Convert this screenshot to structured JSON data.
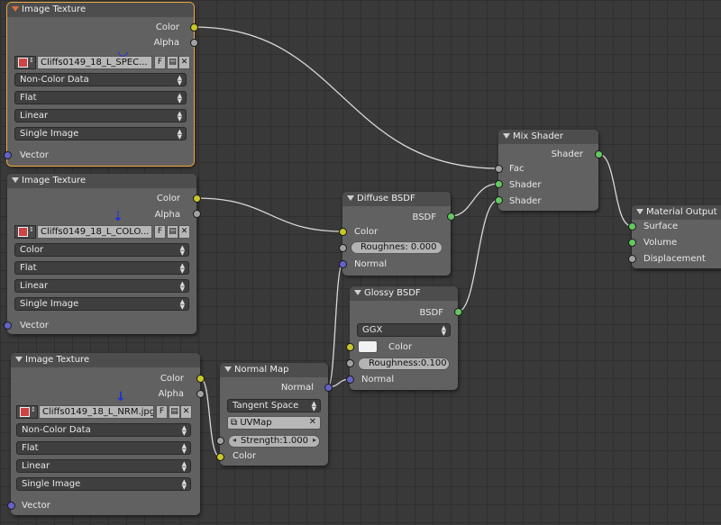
{
  "nodes": {
    "tex1": {
      "title": "Image Texture",
      "out_color": "Color",
      "out_alpha": "Alpha",
      "file": "Cliffs0149_18_L_SPEC...",
      "fake_user": "F",
      "color_space": "Non-Color Data",
      "projection": "Flat",
      "interpolation": "Linear",
      "source": "Single Image",
      "in_vector": "Vector"
    },
    "tex2": {
      "title": "Image Texture",
      "out_color": "Color",
      "out_alpha": "Alpha",
      "file": "Cliffs0149_18_L_COLO...",
      "fake_user": "F",
      "color_space": "Color",
      "projection": "Flat",
      "interpolation": "Linear",
      "source": "Single Image",
      "in_vector": "Vector"
    },
    "tex3": {
      "title": "Image Texture",
      "out_color": "Color",
      "out_alpha": "Alpha",
      "file": "Cliffs0149_18_L_NRM.jpg",
      "fake_user": "F",
      "color_space": "Non-Color Data",
      "projection": "Flat",
      "interpolation": "Linear",
      "source": "Single Image",
      "in_vector": "Vector"
    },
    "diffuse": {
      "title": "Diffuse BSDF",
      "out_bsdf": "BSDF",
      "in_color": "Color",
      "roughness_label": "Roughnes:",
      "roughness_value": "0.000",
      "in_normal": "Normal"
    },
    "glossy": {
      "title": "Glossy BSDF",
      "out_bsdf": "BSDF",
      "distribution": "GGX",
      "in_color": "Color",
      "roughness_label": "Roughness:",
      "roughness_value": "0.100",
      "in_normal": "Normal"
    },
    "normalmap": {
      "title": "Normal Map",
      "out_normal": "Normal",
      "space": "Tangent Space",
      "uvmap": "UVMap",
      "strength_label": "Strength:",
      "strength_value": "1.000",
      "in_color": "Color"
    },
    "mix": {
      "title": "Mix Shader",
      "out_shader": "Shader",
      "in_fac": "Fac",
      "in_shader1": "Shader",
      "in_shader2": "Shader"
    },
    "output": {
      "title": "Material Output",
      "in_surface": "Surface",
      "in_volume": "Volume",
      "in_displacement": "Displacement"
    }
  },
  "colors": {
    "socket_color": "#c7c729",
    "socket_float": "#a1a1a1",
    "socket_vector": "#6363c7",
    "socket_shader": "#63c763",
    "selected_outline": "#f0a740",
    "annotation_arrow": "#1a2fe0"
  }
}
